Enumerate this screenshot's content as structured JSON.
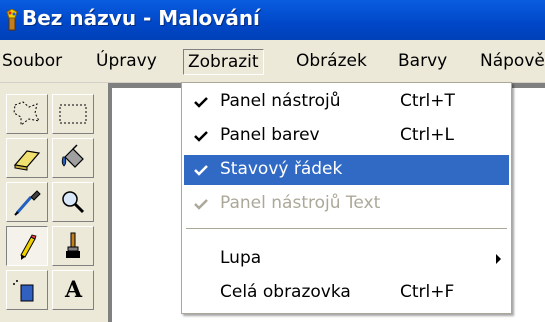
{
  "window": {
    "title": "Bez názvu - Malování",
    "icon": "paint-app-icon"
  },
  "menubar": {
    "items": [
      {
        "label": "Soubor"
      },
      {
        "label": "Úpravy"
      },
      {
        "label": "Zobrazit"
      },
      {
        "label": "Obrázek"
      },
      {
        "label": "Barvy"
      },
      {
        "label": "Nápově"
      }
    ],
    "active_index": 2
  },
  "toolbox": {
    "tools": [
      {
        "name": "free-select-icon"
      },
      {
        "name": "rect-select-icon"
      },
      {
        "name": "eraser-icon"
      },
      {
        "name": "fill-bucket-icon"
      },
      {
        "name": "color-picker-icon"
      },
      {
        "name": "magnifier-icon"
      },
      {
        "name": "pencil-icon"
      },
      {
        "name": "brush-icon"
      },
      {
        "name": "airbrush-icon"
      },
      {
        "name": "text-icon"
      }
    ],
    "text_tool_glyph": "A"
  },
  "view_menu": {
    "items": [
      {
        "label": "Panel nástrojů",
        "shortcut": "Ctrl+T",
        "checked": true,
        "state": "normal"
      },
      {
        "label": "Panel barev",
        "shortcut": "Ctrl+L",
        "checked": true,
        "state": "normal"
      },
      {
        "label": "Stavový řádek",
        "shortcut": "",
        "checked": true,
        "state": "selected"
      },
      {
        "label": "Panel nástrojů Text",
        "shortcut": "",
        "checked": true,
        "state": "disabled"
      },
      {
        "label": "Lupa",
        "shortcut": "",
        "checked": false,
        "state": "submenu"
      },
      {
        "label": "Celá obrazovka",
        "shortcut": "Ctrl+F",
        "checked": false,
        "state": "normal"
      }
    ]
  },
  "colors": {
    "titlebar": "#0047c8",
    "highlight": "#316ac5",
    "disabled_text": "#aca899"
  }
}
